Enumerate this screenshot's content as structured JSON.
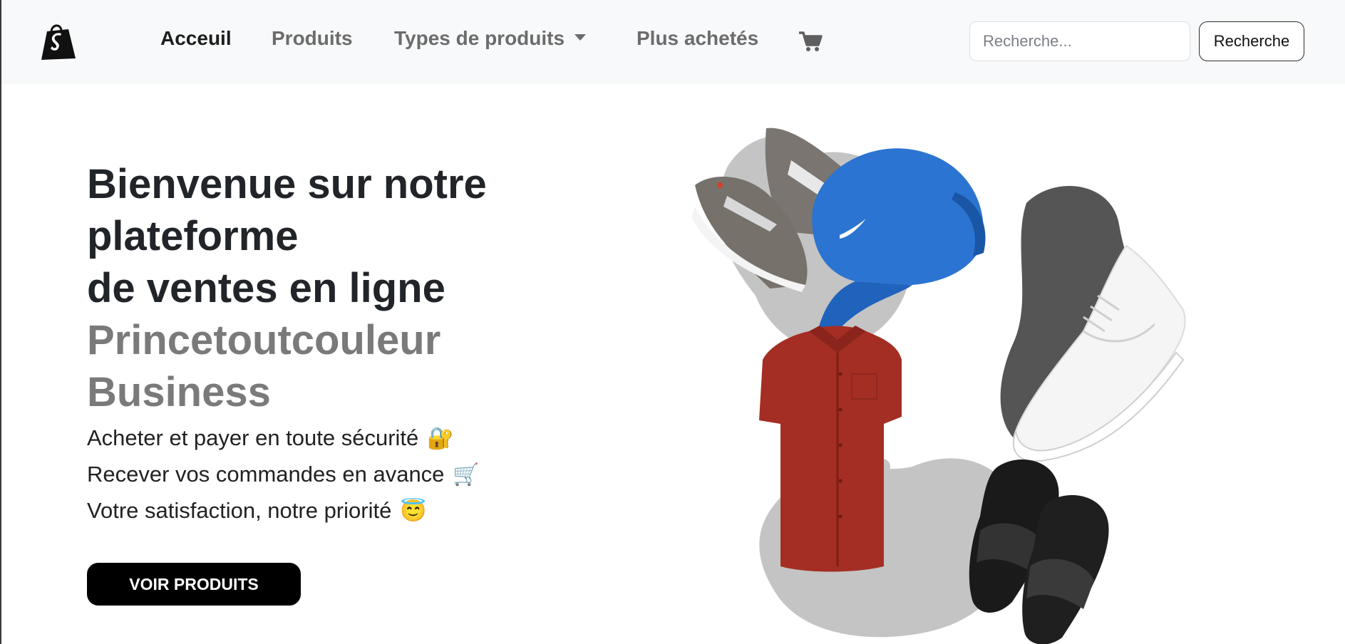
{
  "navbar": {
    "brand_icon": "shopify-bag-icon",
    "links": [
      {
        "label": "Acceuil",
        "active": true
      },
      {
        "label": "Produits",
        "active": false
      },
      {
        "label": "Types de produits",
        "active": false,
        "dropdown": true
      },
      {
        "label": "Plus achetés",
        "active": false
      }
    ],
    "cart_icon": "cart-icon",
    "search": {
      "placeholder": "Recherche...",
      "value": "",
      "button_label": "Recherche"
    }
  },
  "hero": {
    "title_lines": [
      "Bienvenue sur notre",
      "plateforme",
      "de ventes en ligne"
    ],
    "brand_lines": [
      "Princetoutcouleur",
      "Business"
    ],
    "features": [
      {
        "text": "Acheter et payer en toute sécurité",
        "emoji": "🔐"
      },
      {
        "text": "Recever vos commandes en avance",
        "emoji": "🛒"
      },
      {
        "text": "Votre satisfaction, notre priorité",
        "emoji": "😇"
      }
    ],
    "cta_label": "VOIR PRODUITS"
  },
  "illustration": {
    "items": [
      "sneakers-icon",
      "cap-icon",
      "white-sneaker-icon",
      "shirt-icon",
      "slides-icon"
    ]
  },
  "colors": {
    "navbar_bg": "#f8f9fa",
    "active_link": "#1d1d1d",
    "muted_link": "#6c6c6c",
    "brand_text": "#7a7a7a",
    "cta_bg": "#000000"
  }
}
